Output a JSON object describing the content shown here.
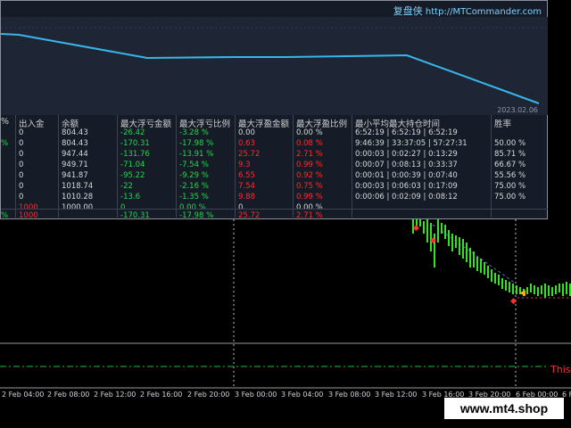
{
  "brand": {
    "name": "复盘侠",
    "url": "http://MTCommander.com"
  },
  "equity": {
    "date_label": "2023.02.06"
  },
  "table": {
    "headers": {
      "pct": "%",
      "inout": "出入金",
      "balance": "余额",
      "max_float_loss": "最大浮亏金额",
      "max_float_loss_pct": "最大浮亏比例",
      "max_float_profit": "最大浮盈金额",
      "max_float_profit_pct": "最大浮盈比例",
      "hold_time": "最小平均最大持仓时间",
      "winrate": "胜率"
    },
    "rows": [
      {
        "prefix": "",
        "inout": "0",
        "balance": "804.43",
        "mfl": "-26.42",
        "mflp": "-3.28 %",
        "mfp": "0.00",
        "mfpp": "0.00 %",
        "hold": "6:52:19 | 6:52:19 | 6:52:19",
        "win": ""
      },
      {
        "prefix": "%",
        "inout": "0",
        "balance": "804.43",
        "mfl": "-170.31",
        "mflp": "-17.98 %",
        "mfp": "0.63",
        "mfpp": "0.08 %",
        "hold": "9:46:39 | 33:37:05 | 57:27:31",
        "win": "50.00 %"
      },
      {
        "prefix": "",
        "inout": "0",
        "balance": "947.44",
        "mfl": "-131.76",
        "mflp": "-13.91 %",
        "mfp": "25.72",
        "mfpp": "2.71 %",
        "hold": "0:00:03 | 0:02:27 | 0:13:29",
        "win": "85.71 %"
      },
      {
        "prefix": "",
        "inout": "0",
        "balance": "949.71",
        "mfl": "-71.04",
        "mflp": "-7.54 %",
        "mfp": "9.3",
        "mfpp": "0.99 %",
        "hold": "0:00:07 | 0:08:13 | 0:33:37",
        "win": "66.67 %"
      },
      {
        "prefix": "",
        "inout": "0",
        "balance": "941.87",
        "mfl": "-95.22",
        "mflp": "-9.29 %",
        "mfp": "6.55",
        "mfpp": "0.92 %",
        "hold": "0:00:01 | 0:00:39 | 0:07:40",
        "win": "55.56 %"
      },
      {
        "prefix": "",
        "inout": "0",
        "balance": "1018.74",
        "mfl": "-22",
        "mflp": "-2.16 %",
        "mfp": "7.54",
        "mfpp": "0.75 %",
        "hold": "0:00:03 | 0:06:03 | 0:17:09",
        "win": "75.00 %"
      },
      {
        "prefix": "",
        "inout": "0",
        "balance": "1010.28",
        "mfl": "-13.6",
        "mflp": "-1.35 %",
        "mfp": "9.88",
        "mfpp": "0.99 %",
        "hold": "0:00:06 | 0:02:09 | 0:08:12",
        "win": "75.00 %"
      },
      {
        "prefix": "",
        "inout": "1000",
        "balance": "1000.00",
        "mfl": "0",
        "mflp": "0.00 %",
        "mfp": "0",
        "mfpp": "0.00 %",
        "hold": "",
        "win": ""
      }
    ],
    "total": {
      "prefix": "%",
      "inout": "1000",
      "balance": "",
      "mfl": "-170.31",
      "mflp": "-17.98 %",
      "mfp": "25.72",
      "mfpp": "2.71 %",
      "hold": "",
      "win": ""
    }
  },
  "xaxis": {
    "ticks": [
      "2 Feb 04:00",
      "2 Feb 08:00",
      "2 Feb 12:00",
      "2 Feb 16:00",
      "2 Feb 20:00",
      "3 Feb 00:00",
      "3 Feb 04:00",
      "3 Feb 08:00",
      "3 Feb 12:00",
      "3 Feb 16:00",
      "3 Feb 20:00",
      "6 Feb 00:00",
      "6 Fe"
    ]
  },
  "chart": {
    "this_label": "This",
    "colors": {
      "candle": "#3adf2a",
      "line": "#38b6e8",
      "trade": "#ff3030"
    }
  },
  "watermark": "www.mt4.shop"
}
